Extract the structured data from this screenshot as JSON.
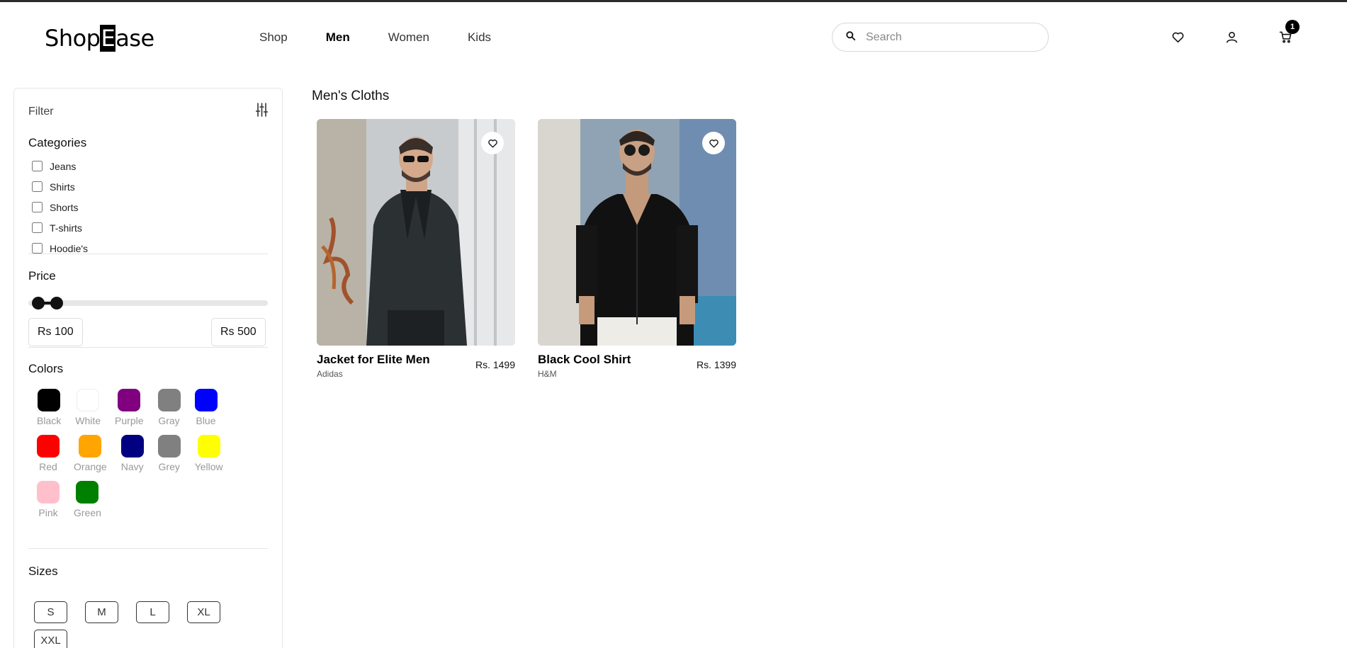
{
  "brand": {
    "pre": "Shop",
    "highlight": "E",
    "post": "ase"
  },
  "nav": [
    {
      "label": "Shop"
    },
    {
      "label": "Men"
    },
    {
      "label": "Women"
    },
    {
      "label": "Kids"
    }
  ],
  "active_nav": "Men",
  "search": {
    "placeholder": "Search",
    "value": ""
  },
  "header_icons": [
    "heart-icon",
    "user-icon",
    "cart-icon"
  ],
  "cart": {
    "count": "1"
  },
  "filter": {
    "title": "Filter",
    "categories": {
      "title": "Categories",
      "items": [
        "Jeans",
        "Shirts",
        "Shorts",
        "T-shirts",
        "Hoodie's"
      ]
    },
    "price": {
      "title": "Price",
      "min_label": "Rs 100",
      "max_label": "Rs 500"
    },
    "colors": {
      "title": "Colors",
      "items": [
        {
          "name": "Black",
          "hex": "#000000"
        },
        {
          "name": "White",
          "hex": "#ffffff"
        },
        {
          "name": "Purple",
          "hex": "#800080"
        },
        {
          "name": "Gray",
          "hex": "#808080"
        },
        {
          "name": "Blue",
          "hex": "#0000ff"
        },
        {
          "name": "Red",
          "hex": "#ff0000"
        },
        {
          "name": "Orange",
          "hex": "#ffa500"
        },
        {
          "name": "Navy",
          "hex": "#000080"
        },
        {
          "name": "Grey",
          "hex": "#808080"
        },
        {
          "name": "Yellow",
          "hex": "#ffff00"
        },
        {
          "name": "Pink",
          "hex": "#ffc0cb"
        },
        {
          "name": "Green",
          "hex": "#008000"
        }
      ]
    },
    "sizes": {
      "title": "Sizes",
      "items": [
        "S",
        "M",
        "L",
        "XL",
        "XXL"
      ]
    }
  },
  "main": {
    "title": "Men's Cloths",
    "products": [
      {
        "name": "Jacket for Elite Men",
        "brand": "Adidas",
        "price": "Rs. 1499"
      },
      {
        "name": "Black Cool Shirt",
        "brand": "H&M",
        "price": "Rs. 1399"
      }
    ]
  }
}
